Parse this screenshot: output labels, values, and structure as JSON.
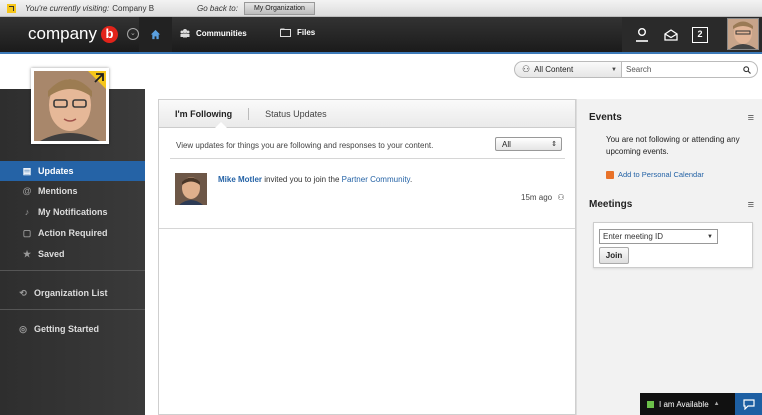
{
  "visit_bar": {
    "visiting_label": "You're currently visiting:",
    "company": "Company B",
    "goback_label": "Go back to:",
    "my_org_button": "My Organization"
  },
  "topnav": {
    "logo_text": "company",
    "logo_letter": "b",
    "communities": "Communities",
    "files": "Files",
    "messages_count": "2"
  },
  "search": {
    "scope": "All Content",
    "placeholder": "Search"
  },
  "sidebar": {
    "items": [
      {
        "label": "Updates",
        "icon": "updates-icon",
        "active": true
      },
      {
        "label": "Mentions",
        "icon": "at-icon"
      },
      {
        "label": "My Notifications",
        "icon": "bell-icon"
      },
      {
        "label": "Action Required",
        "icon": "clipboard-icon"
      },
      {
        "label": "Saved",
        "icon": "star-icon"
      }
    ],
    "org_list": "Organization List",
    "getting_started": "Getting Started"
  },
  "main": {
    "tabs": [
      {
        "label": "I'm Following",
        "active": true
      },
      {
        "label": "Status Updates"
      }
    ],
    "view_text": "View updates for things you are following and responses to your content.",
    "filter": "All",
    "story": {
      "actor": "Mike Motler",
      "action": " invited you to join the ",
      "target": "Partner Community",
      "end": ".",
      "time": "15m ago"
    }
  },
  "right": {
    "events_title": "Events",
    "events_msg": "You are not following or attending any upcoming events.",
    "calendar_link": "Add to Personal Calendar",
    "meetings_title": "Meetings",
    "meeting_placeholder": "Enter meeting ID",
    "join_button": "Join"
  },
  "status": {
    "availability": "I am Available"
  },
  "colors": {
    "accent": "#2563a6",
    "brand_red": "#e2231a",
    "available_green": "#6cc04a"
  }
}
